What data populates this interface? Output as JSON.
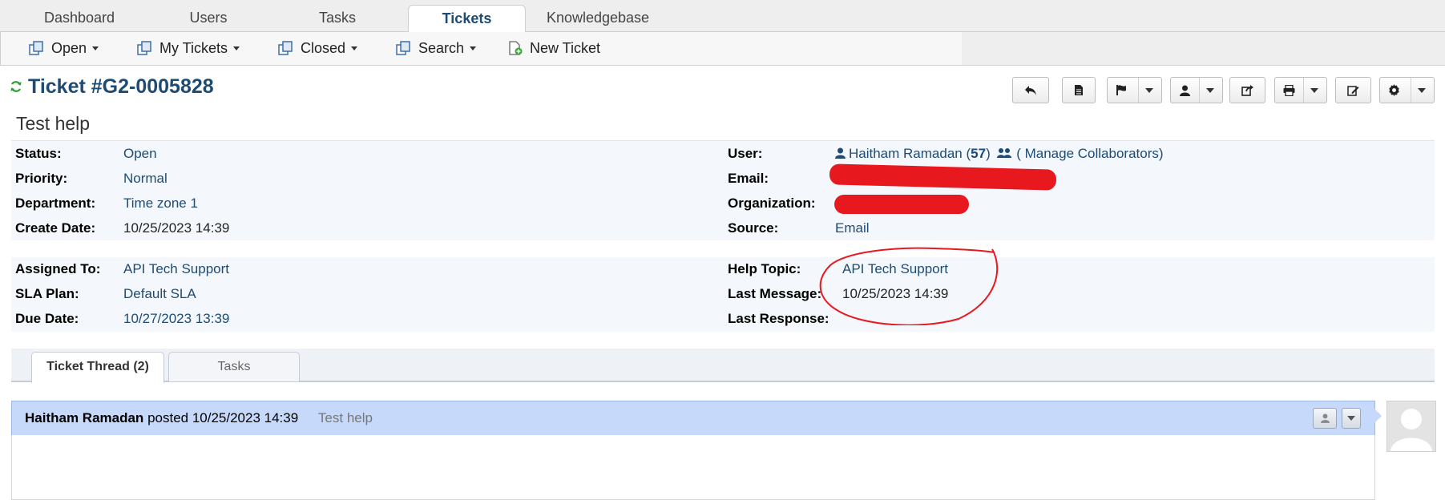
{
  "top_nav": {
    "tabs": [
      {
        "label": "Dashboard"
      },
      {
        "label": "Users"
      },
      {
        "label": "Tasks"
      },
      {
        "label": "Tickets"
      },
      {
        "label": "Knowledgebase"
      }
    ],
    "active_tab": "Tickets"
  },
  "sub_nav": {
    "open": "Open",
    "my_tickets": "My Tickets",
    "closed": "Closed",
    "search": "Search",
    "new_ticket": "New Ticket"
  },
  "ticket": {
    "title": "Ticket #G2-0005828",
    "subject": "Test help"
  },
  "info": {
    "status_label": "Status:",
    "status": "Open",
    "priority_label": "Priority:",
    "priority": "Normal",
    "department_label": "Department:",
    "department": "Time zone 1",
    "create_date_label": "Create Date:",
    "create_date": "10/25/2023 14:39",
    "user_label": "User:",
    "user_name": "Haitham Ramadan",
    "user_open": "(",
    "user_count": "57",
    "user_close": ")",
    "manage_collaborators": "( Manage Collaborators)",
    "email_label": "Email:",
    "organization_label": "Organization:",
    "source_label": "Source:",
    "source": "Email",
    "assigned_to_label": "Assigned To:",
    "assigned_to": "API Tech Support",
    "sla_plan_label": "SLA Plan:",
    "sla_plan": "Default SLA",
    "due_date_label": "Due Date:",
    "due_date": "10/27/2023 13:39",
    "help_topic_label": "Help Topic:",
    "help_topic": "API Tech Support",
    "last_message_label": "Last Message:",
    "last_message": "10/25/2023 14:39",
    "last_response_label": "Last Response:"
  },
  "thread_tabs": {
    "thread": "Ticket Thread (2)",
    "tasks": "Tasks"
  },
  "entry": {
    "author": "Haitham Ramadan",
    "posted": "posted 10/25/2023 14:39",
    "subject": "Test help"
  },
  "colors": {
    "accent": "#1e4b74",
    "entry_header": "#c6d9fb",
    "annotation": "#e8181f"
  }
}
